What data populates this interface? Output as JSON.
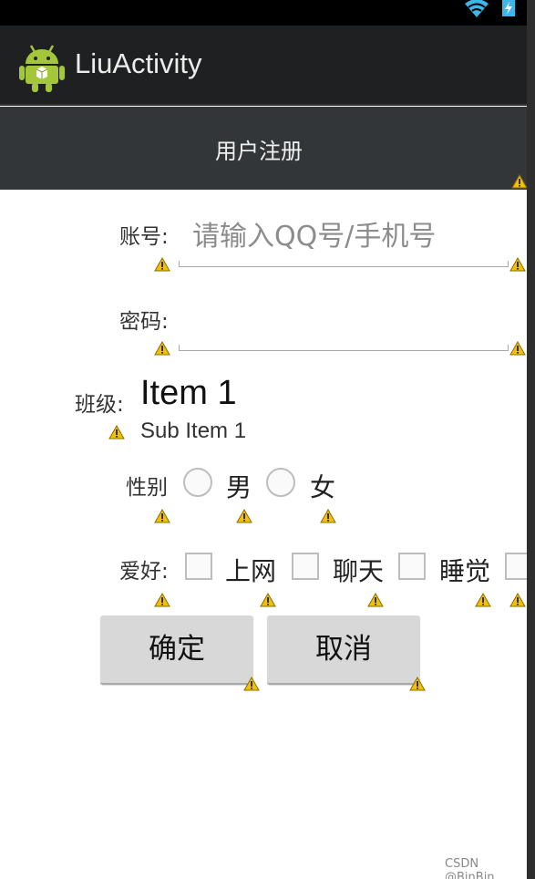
{
  "status_bar": {
    "wifi_icon": "wifi-icon",
    "battery_icon": "battery-charging-icon"
  },
  "action_bar": {
    "app_icon": "android-robot-icon",
    "title": "LiuActivity"
  },
  "header": {
    "title": "用户注册"
  },
  "form": {
    "account": {
      "label": "账号:",
      "placeholder": "请输入QQ号/手机号",
      "value": ""
    },
    "password": {
      "label": "密码:",
      "value": ""
    },
    "class": {
      "label": "班级:",
      "item": "Item 1",
      "sub_item": "Sub Item 1"
    },
    "gender": {
      "label": "性别",
      "options": [
        "男",
        "女"
      ]
    },
    "hobbies": {
      "label": "爱好:",
      "options": [
        "上网",
        "聊天",
        "睡觉"
      ]
    }
  },
  "buttons": {
    "confirm": "确定",
    "cancel": "取消"
  },
  "watermark": "CSDN @BinBin",
  "colors": {
    "status_bar": "#000000",
    "action_bar": "#1f2021",
    "header_bar": "#323639",
    "button": "#d8d8d8",
    "warning": "#f2c200"
  }
}
